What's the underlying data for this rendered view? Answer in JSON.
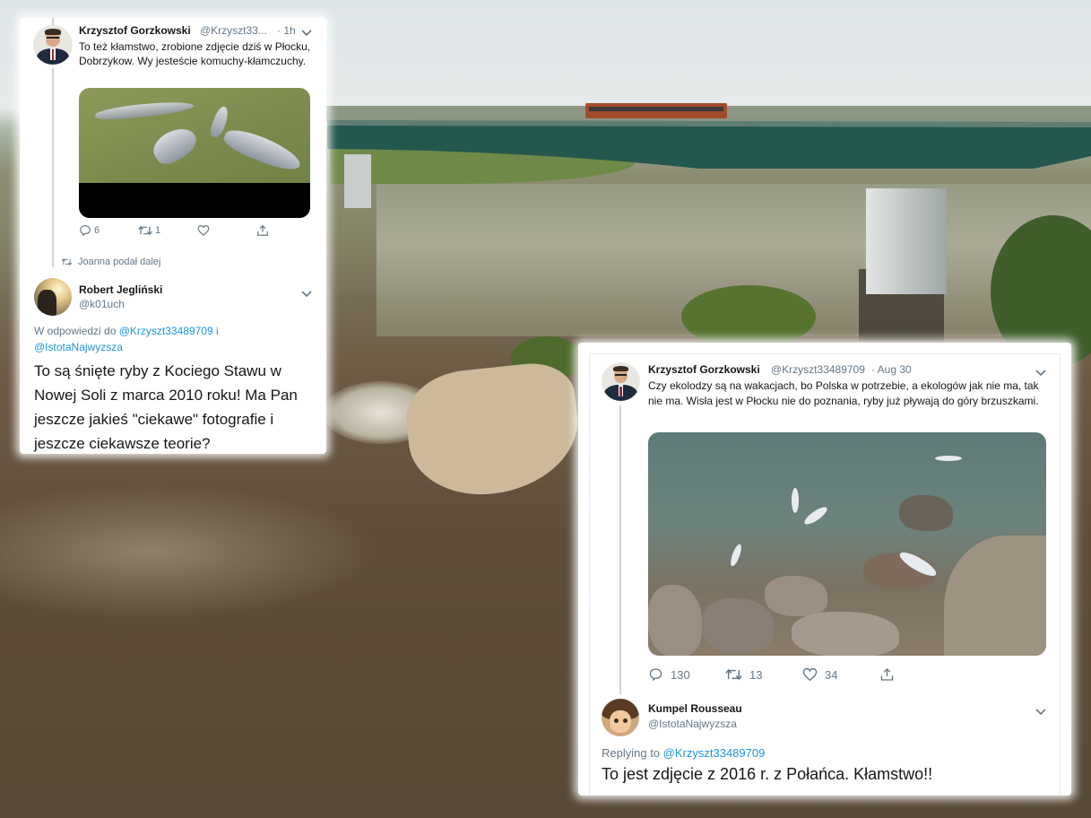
{
  "tweet1": {
    "author_name": "Krzysztof Gorzkowski",
    "author_handle": "@Krzyszt33...",
    "time": "· 1h",
    "text": "To też kłamstwo, zrobione zdjęcie dziś w Płocku, Dobrzykow. Wy jesteście komuchy-kłamczuchy.",
    "replies": "6",
    "retweets": "1",
    "likes": "",
    "retweeted_by": "Joanna podał dalej"
  },
  "tweet2": {
    "author_name": "Robert Jegliński",
    "author_handle": "@k01uch",
    "reply_prefix": "W odpowiedzi do",
    "reply_to_1": "@Krzyszt33489709 i",
    "reply_to_2": "@IstotaNajwyzsza",
    "text": "To są śnięte ryby z Kociego Stawu w Nowej Soli z marca 2010 roku! Ma Pan jeszcze jakieś \"ciekawe\" fotografie i jeszcze ciekawsze teorie?"
  },
  "tweet3": {
    "author_name": "Krzysztof Gorzkowski",
    "author_handle": "@Krzyszt33489709",
    "time": "· Aug 30",
    "text": "Czy ekolodzy są na wakacjach, bo Polska w potrzebie, a ekologów jak nie ma, tak nie ma. Wisła jest w Płocku nie do poznania, ryby już pływają do góry brzuszkami.",
    "replies": "130",
    "retweets": "13",
    "likes": "34"
  },
  "tweet4": {
    "author_name": "Kumpel Rousseau",
    "author_handle": "@IstotaNajwyzsza",
    "reply_prefix": "Replying to",
    "reply_to": "@Krzyszt33489709",
    "text": "To jest zdjęcie z 2016 r. z Połańca. Kłamstwo!!"
  },
  "icons": [
    "reply-icon",
    "retweet-icon",
    "like-icon",
    "share-icon",
    "chevron-down-icon",
    "retweet-small-icon"
  ],
  "colors": {
    "link": "#1b95e0",
    "text": "#14171a",
    "muted": "#657786"
  }
}
